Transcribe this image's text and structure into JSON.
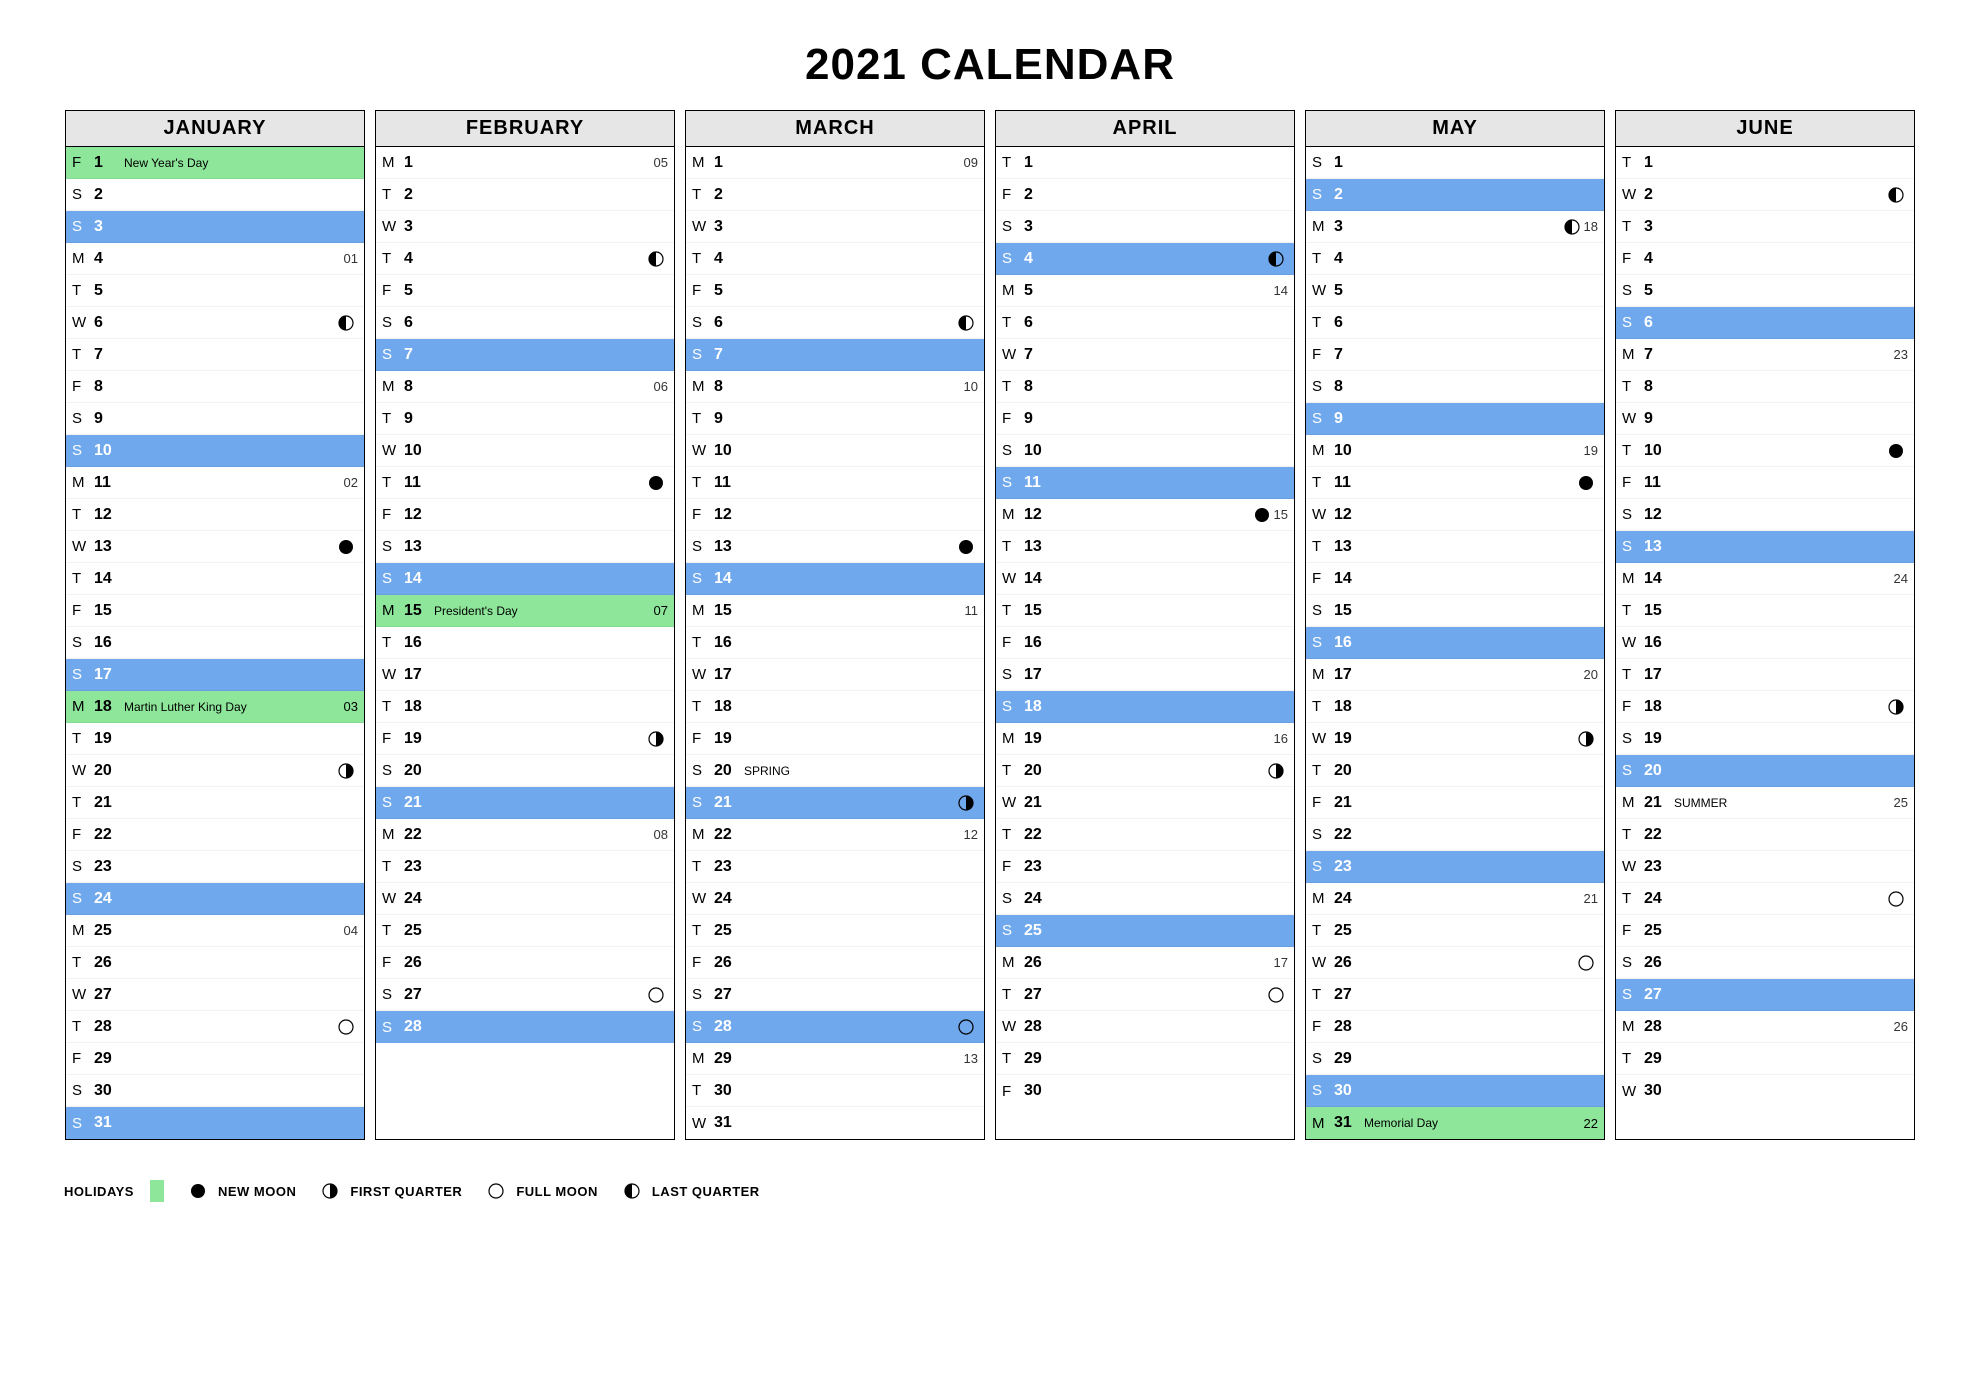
{
  "title": "2021 CALENDAR",
  "legend": {
    "holidays": "HOLIDAYS",
    "new_moon": "NEW MOON",
    "first_quarter": "FIRST QUARTER",
    "full_moon": "FULL MOON",
    "last_quarter": "LAST QUARTER"
  },
  "months": [
    {
      "name": "JANUARY",
      "days": [
        {
          "dow": "F",
          "num": "1",
          "holiday": true,
          "note": "New Year's Day"
        },
        {
          "dow": "S",
          "num": "2"
        },
        {
          "dow": "S",
          "num": "3",
          "sunday": true
        },
        {
          "dow": "M",
          "num": "4",
          "wk": "01"
        },
        {
          "dow": "T",
          "num": "5"
        },
        {
          "dow": "W",
          "num": "6",
          "moon": "last"
        },
        {
          "dow": "T",
          "num": "7"
        },
        {
          "dow": "F",
          "num": "8"
        },
        {
          "dow": "S",
          "num": "9"
        },
        {
          "dow": "S",
          "num": "10",
          "sunday": true
        },
        {
          "dow": "M",
          "num": "11",
          "wk": "02"
        },
        {
          "dow": "T",
          "num": "12"
        },
        {
          "dow": "W",
          "num": "13",
          "moon": "new"
        },
        {
          "dow": "T",
          "num": "14"
        },
        {
          "dow": "F",
          "num": "15"
        },
        {
          "dow": "S",
          "num": "16"
        },
        {
          "dow": "S",
          "num": "17",
          "sunday": true
        },
        {
          "dow": "M",
          "num": "18",
          "holiday": true,
          "note": "Martin Luther King Day",
          "wk": "03"
        },
        {
          "dow": "T",
          "num": "19"
        },
        {
          "dow": "W",
          "num": "20",
          "moon": "first"
        },
        {
          "dow": "T",
          "num": "21"
        },
        {
          "dow": "F",
          "num": "22"
        },
        {
          "dow": "S",
          "num": "23"
        },
        {
          "dow": "S",
          "num": "24",
          "sunday": true
        },
        {
          "dow": "M",
          "num": "25",
          "wk": "04"
        },
        {
          "dow": "T",
          "num": "26"
        },
        {
          "dow": "W",
          "num": "27"
        },
        {
          "dow": "T",
          "num": "28",
          "moon": "full"
        },
        {
          "dow": "F",
          "num": "29"
        },
        {
          "dow": "S",
          "num": "30"
        },
        {
          "dow": "S",
          "num": "31",
          "sunday": true
        }
      ]
    },
    {
      "name": "FEBRUARY",
      "days": [
        {
          "dow": "M",
          "num": "1",
          "wk": "05"
        },
        {
          "dow": "T",
          "num": "2"
        },
        {
          "dow": "W",
          "num": "3"
        },
        {
          "dow": "T",
          "num": "4",
          "moon": "last"
        },
        {
          "dow": "F",
          "num": "5"
        },
        {
          "dow": "S",
          "num": "6"
        },
        {
          "dow": "S",
          "num": "7",
          "sunday": true
        },
        {
          "dow": "M",
          "num": "8",
          "wk": "06"
        },
        {
          "dow": "T",
          "num": "9"
        },
        {
          "dow": "W",
          "num": "10"
        },
        {
          "dow": "T",
          "num": "11",
          "moon": "new"
        },
        {
          "dow": "F",
          "num": "12"
        },
        {
          "dow": "S",
          "num": "13"
        },
        {
          "dow": "S",
          "num": "14",
          "sunday": true
        },
        {
          "dow": "M",
          "num": "15",
          "holiday": true,
          "note": "President's Day",
          "wk": "07"
        },
        {
          "dow": "T",
          "num": "16"
        },
        {
          "dow": "W",
          "num": "17"
        },
        {
          "dow": "T",
          "num": "18"
        },
        {
          "dow": "F",
          "num": "19",
          "moon": "first"
        },
        {
          "dow": "S",
          "num": "20"
        },
        {
          "dow": "S",
          "num": "21",
          "sunday": true
        },
        {
          "dow": "M",
          "num": "22",
          "wk": "08"
        },
        {
          "dow": "T",
          "num": "23"
        },
        {
          "dow": "W",
          "num": "24"
        },
        {
          "dow": "T",
          "num": "25"
        },
        {
          "dow": "F",
          "num": "26"
        },
        {
          "dow": "S",
          "num": "27",
          "moon": "full"
        },
        {
          "dow": "S",
          "num": "28",
          "sunday": true
        }
      ]
    },
    {
      "name": "MARCH",
      "days": [
        {
          "dow": "M",
          "num": "1",
          "wk": "09"
        },
        {
          "dow": "T",
          "num": "2"
        },
        {
          "dow": "W",
          "num": "3"
        },
        {
          "dow": "T",
          "num": "4"
        },
        {
          "dow": "F",
          "num": "5"
        },
        {
          "dow": "S",
          "num": "6",
          "moon": "last"
        },
        {
          "dow": "S",
          "num": "7",
          "sunday": true
        },
        {
          "dow": "M",
          "num": "8",
          "wk": "10"
        },
        {
          "dow": "T",
          "num": "9"
        },
        {
          "dow": "W",
          "num": "10"
        },
        {
          "dow": "T",
          "num": "11"
        },
        {
          "dow": "F",
          "num": "12"
        },
        {
          "dow": "S",
          "num": "13",
          "moon": "new"
        },
        {
          "dow": "S",
          "num": "14",
          "sunday": true
        },
        {
          "dow": "M",
          "num": "15",
          "wk": "11"
        },
        {
          "dow": "T",
          "num": "16"
        },
        {
          "dow": "W",
          "num": "17"
        },
        {
          "dow": "T",
          "num": "18"
        },
        {
          "dow": "F",
          "num": "19"
        },
        {
          "dow": "S",
          "num": "20",
          "note": "SPRING"
        },
        {
          "dow": "S",
          "num": "21",
          "sunday": true,
          "moon": "first"
        },
        {
          "dow": "M",
          "num": "22",
          "wk": "12"
        },
        {
          "dow": "T",
          "num": "23"
        },
        {
          "dow": "W",
          "num": "24"
        },
        {
          "dow": "T",
          "num": "25"
        },
        {
          "dow": "F",
          "num": "26"
        },
        {
          "dow": "S",
          "num": "27"
        },
        {
          "dow": "S",
          "num": "28",
          "sunday": true,
          "moon": "full"
        },
        {
          "dow": "M",
          "num": "29",
          "wk": "13"
        },
        {
          "dow": "T",
          "num": "30"
        },
        {
          "dow": "W",
          "num": "31"
        }
      ]
    },
    {
      "name": "APRIL",
      "days": [
        {
          "dow": "T",
          "num": "1"
        },
        {
          "dow": "F",
          "num": "2"
        },
        {
          "dow": "S",
          "num": "3"
        },
        {
          "dow": "S",
          "num": "4",
          "sunday": true,
          "moon": "last"
        },
        {
          "dow": "M",
          "num": "5",
          "wk": "14"
        },
        {
          "dow": "T",
          "num": "6"
        },
        {
          "dow": "W",
          "num": "7"
        },
        {
          "dow": "T",
          "num": "8"
        },
        {
          "dow": "F",
          "num": "9"
        },
        {
          "dow": "S",
          "num": "10"
        },
        {
          "dow": "S",
          "num": "11",
          "sunday": true
        },
        {
          "dow": "M",
          "num": "12",
          "moon": "new",
          "wk": "15"
        },
        {
          "dow": "T",
          "num": "13"
        },
        {
          "dow": "W",
          "num": "14"
        },
        {
          "dow": "T",
          "num": "15"
        },
        {
          "dow": "F",
          "num": "16"
        },
        {
          "dow": "S",
          "num": "17"
        },
        {
          "dow": "S",
          "num": "18",
          "sunday": true
        },
        {
          "dow": "M",
          "num": "19",
          "wk": "16"
        },
        {
          "dow": "T",
          "num": "20",
          "moon": "first"
        },
        {
          "dow": "W",
          "num": "21"
        },
        {
          "dow": "T",
          "num": "22"
        },
        {
          "dow": "F",
          "num": "23"
        },
        {
          "dow": "S",
          "num": "24"
        },
        {
          "dow": "S",
          "num": "25",
          "sunday": true
        },
        {
          "dow": "M",
          "num": "26",
          "wk": "17"
        },
        {
          "dow": "T",
          "num": "27",
          "moon": "full"
        },
        {
          "dow": "W",
          "num": "28"
        },
        {
          "dow": "T",
          "num": "29"
        },
        {
          "dow": "F",
          "num": "30"
        }
      ]
    },
    {
      "name": "MAY",
      "days": [
        {
          "dow": "S",
          "num": "1"
        },
        {
          "dow": "S",
          "num": "2",
          "sunday": true
        },
        {
          "dow": "M",
          "num": "3",
          "moon": "last",
          "wk": "18"
        },
        {
          "dow": "T",
          "num": "4"
        },
        {
          "dow": "W",
          "num": "5"
        },
        {
          "dow": "T",
          "num": "6"
        },
        {
          "dow": "F",
          "num": "7"
        },
        {
          "dow": "S",
          "num": "8"
        },
        {
          "dow": "S",
          "num": "9",
          "sunday": true
        },
        {
          "dow": "M",
          "num": "10",
          "wk": "19"
        },
        {
          "dow": "T",
          "num": "11",
          "moon": "new"
        },
        {
          "dow": "W",
          "num": "12"
        },
        {
          "dow": "T",
          "num": "13"
        },
        {
          "dow": "F",
          "num": "14"
        },
        {
          "dow": "S",
          "num": "15"
        },
        {
          "dow": "S",
          "num": "16",
          "sunday": true
        },
        {
          "dow": "M",
          "num": "17",
          "wk": "20"
        },
        {
          "dow": "T",
          "num": "18"
        },
        {
          "dow": "W",
          "num": "19",
          "moon": "first"
        },
        {
          "dow": "T",
          "num": "20"
        },
        {
          "dow": "F",
          "num": "21"
        },
        {
          "dow": "S",
          "num": "22"
        },
        {
          "dow": "S",
          "num": "23",
          "sunday": true
        },
        {
          "dow": "M",
          "num": "24",
          "wk": "21"
        },
        {
          "dow": "T",
          "num": "25"
        },
        {
          "dow": "W",
          "num": "26",
          "moon": "full"
        },
        {
          "dow": "T",
          "num": "27"
        },
        {
          "dow": "F",
          "num": "28"
        },
        {
          "dow": "S",
          "num": "29"
        },
        {
          "dow": "S",
          "num": "30",
          "sunday": true
        },
        {
          "dow": "M",
          "num": "31",
          "holiday": true,
          "note": "Memorial Day",
          "wk": "22"
        }
      ]
    },
    {
      "name": "JUNE",
      "days": [
        {
          "dow": "T",
          "num": "1"
        },
        {
          "dow": "W",
          "num": "2",
          "moon": "last"
        },
        {
          "dow": "T",
          "num": "3"
        },
        {
          "dow": "F",
          "num": "4"
        },
        {
          "dow": "S",
          "num": "5"
        },
        {
          "dow": "S",
          "num": "6",
          "sunday": true
        },
        {
          "dow": "M",
          "num": "7",
          "wk": "23"
        },
        {
          "dow": "T",
          "num": "8"
        },
        {
          "dow": "W",
          "num": "9"
        },
        {
          "dow": "T",
          "num": "10",
          "moon": "new"
        },
        {
          "dow": "F",
          "num": "11"
        },
        {
          "dow": "S",
          "num": "12"
        },
        {
          "dow": "S",
          "num": "13",
          "sunday": true
        },
        {
          "dow": "M",
          "num": "14",
          "wk": "24"
        },
        {
          "dow": "T",
          "num": "15"
        },
        {
          "dow": "W",
          "num": "16"
        },
        {
          "dow": "T",
          "num": "17"
        },
        {
          "dow": "F",
          "num": "18",
          "moon": "first"
        },
        {
          "dow": "S",
          "num": "19"
        },
        {
          "dow": "S",
          "num": "20",
          "sunday": true
        },
        {
          "dow": "M",
          "num": "21",
          "note": "SUMMER",
          "wk": "25"
        },
        {
          "dow": "T",
          "num": "22"
        },
        {
          "dow": "W",
          "num": "23"
        },
        {
          "dow": "T",
          "num": "24",
          "moon": "full"
        },
        {
          "dow": "F",
          "num": "25"
        },
        {
          "dow": "S",
          "num": "26"
        },
        {
          "dow": "S",
          "num": "27",
          "sunday": true
        },
        {
          "dow": "M",
          "num": "28",
          "wk": "26"
        },
        {
          "dow": "T",
          "num": "29"
        },
        {
          "dow": "W",
          "num": "30"
        }
      ]
    }
  ]
}
